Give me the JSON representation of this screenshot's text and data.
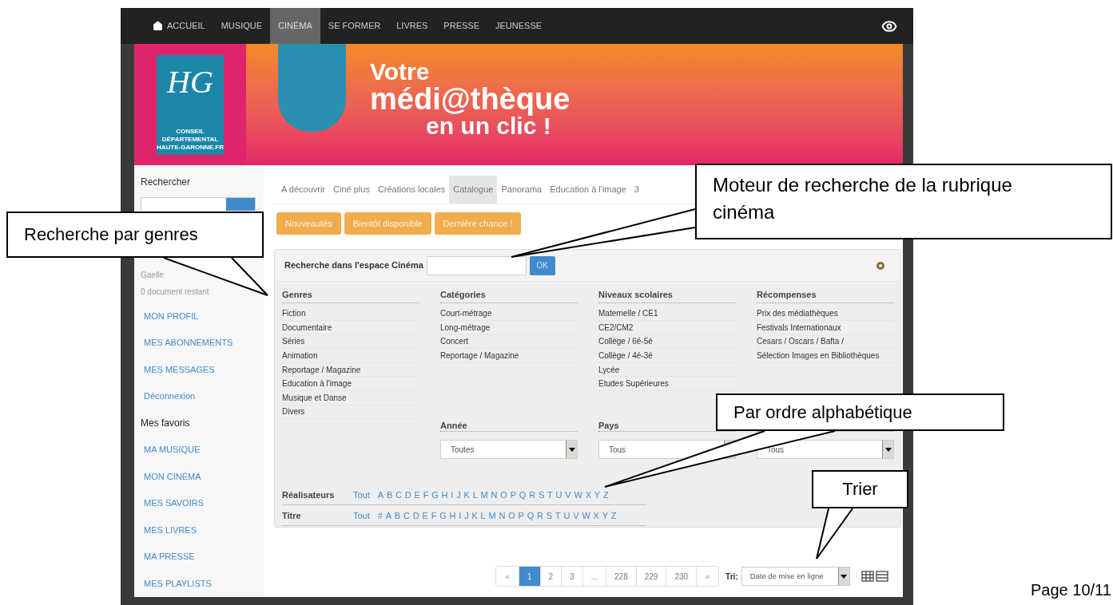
{
  "document": {
    "page_number": "Page 10/11"
  },
  "nav": {
    "items": [
      {
        "label": "ACCUEIL",
        "kind": "home",
        "selected": false
      },
      {
        "label": "MUSIQUE",
        "kind": "link",
        "selected": false
      },
      {
        "label": "CINÉMA",
        "kind": "link",
        "selected": true
      },
      {
        "label": "SE FORMER",
        "kind": "link",
        "selected": false
      },
      {
        "label": "LIVRES",
        "kind": "link",
        "selected": false
      },
      {
        "label": "PRESSE",
        "kind": "link",
        "selected": false
      },
      {
        "label": "JEUNESSE",
        "kind": "link",
        "selected": false
      }
    ]
  },
  "banner": {
    "logo_text": "HG",
    "logo_caption": [
      "CONSEIL DÉPARTEMENTAL",
      "HAUTE-GARONNE.FR"
    ],
    "headline": [
      "Votre",
      "médi@thèque",
      "en un clic !"
    ]
  },
  "sidebar": {
    "search_title": "Rechercher",
    "user_name": "Gaelle",
    "documents_left": "0 document restant",
    "items": [
      {
        "label": "MON PROFIL",
        "kind": "link"
      },
      {
        "label": "MES ABONNEMENTS",
        "kind": "link"
      },
      {
        "label": "MES MESSAGES",
        "kind": "link"
      },
      {
        "label": "Déconnexion",
        "kind": "link"
      },
      {
        "label": "Mes favoris",
        "kind": "heading"
      },
      {
        "label": "MA MUSIQUE",
        "kind": "link"
      },
      {
        "label": "MON CINÉMA",
        "kind": "link"
      },
      {
        "label": "MES SAVOIRS",
        "kind": "link"
      },
      {
        "label": "MES LIVRES",
        "kind": "link"
      },
      {
        "label": "MA PRESSE",
        "kind": "link"
      },
      {
        "label": "MES PLAYLISTS",
        "kind": "link"
      }
    ]
  },
  "tabs": [
    {
      "label": "A découvrir",
      "selected": false
    },
    {
      "label": "Ciné plus",
      "selected": false
    },
    {
      "label": "Créations locales",
      "selected": false
    },
    {
      "label": "Catalogue",
      "selected": true
    },
    {
      "label": "Panorama",
      "selected": false
    },
    {
      "label": "Education à l'image",
      "selected": false
    },
    {
      "label": "3",
      "selected": false
    }
  ],
  "quick_buttons": [
    "Nouveautés",
    "Bientôt disponible",
    "Dernière chance !"
  ],
  "search_panel": {
    "label": "Recherche dans l'espace Cinéma",
    "button": "OK",
    "columns": [
      {
        "heading": "Genres",
        "items": [
          "Fiction",
          "Documentaire",
          "Séries",
          "Animation",
          "Reportage / Magazine",
          "Education à l'image",
          "Musique et Danse",
          "Divers"
        ]
      },
      {
        "heading": "Catégories",
        "items": [
          "Court-métrage",
          "Long-métrage",
          "Concert",
          "Reportage / Magazine"
        ]
      },
      {
        "heading": "Niveaux scolaires",
        "items": [
          "Maternelle / CE1",
          "CE2/CM2",
          "Collège / 6é-5é",
          "Collège / 4é-3é",
          "Lycée",
          "Etudes Supérieures"
        ]
      },
      {
        "heading": "Récompenses",
        "items": [
          "Prix des médiathèques",
          "Festivals Internationaux",
          "Cesars / Oscars / Bafta /",
          "Sélection Images en Bibliothèques"
        ]
      }
    ],
    "filters": [
      {
        "label": "Année",
        "value": "Toutes"
      },
      {
        "label": "Pays",
        "value": "Tous"
      },
      {
        "value": "Tous"
      }
    ],
    "letter_rows": [
      {
        "label": "Réalisateurs",
        "all": "Tout",
        "letters": [
          "A",
          "B",
          "C",
          "D",
          "E",
          "F",
          "G",
          "H",
          "I",
          "J",
          "K",
          "L",
          "M",
          "N",
          "O",
          "P",
          "Q",
          "R",
          "S",
          "T",
          "U",
          "V",
          "W",
          "X",
          "Y",
          "Z"
        ]
      },
      {
        "label": "Titre",
        "all": "Tout",
        "letters": [
          "#",
          "A",
          "B",
          "C",
          "D",
          "E",
          "F",
          "G",
          "H",
          "I",
          "J",
          "K",
          "L",
          "M",
          "N",
          "O",
          "P",
          "Q",
          "R",
          "S",
          "T",
          "U",
          "V",
          "W",
          "X",
          "Y",
          "Z"
        ]
      }
    ]
  },
  "pagination": {
    "prev": "«",
    "next": "»",
    "pages": [
      {
        "label": "1",
        "kind": "page",
        "selected": true
      },
      {
        "label": "2",
        "kind": "page",
        "selected": false
      },
      {
        "label": "3",
        "kind": "page",
        "selected": false
      },
      {
        "label": "...",
        "kind": "ellipsis",
        "selected": false
      },
      {
        "label": "228",
        "kind": "page",
        "selected": false
      },
      {
        "label": "229",
        "kind": "page",
        "selected": false
      },
      {
        "label": "230",
        "kind": "page",
        "selected": false
      }
    ]
  },
  "sort": {
    "label": "Tri:",
    "value": "Date de mise en ligne"
  },
  "callouts": [
    {
      "text": "Recherche par genres"
    },
    {
      "text": "Moteur de recherche de la rubrique cinéma"
    },
    {
      "text": "Par ordre alphabétique"
    },
    {
      "text": "Trier"
    }
  ]
}
